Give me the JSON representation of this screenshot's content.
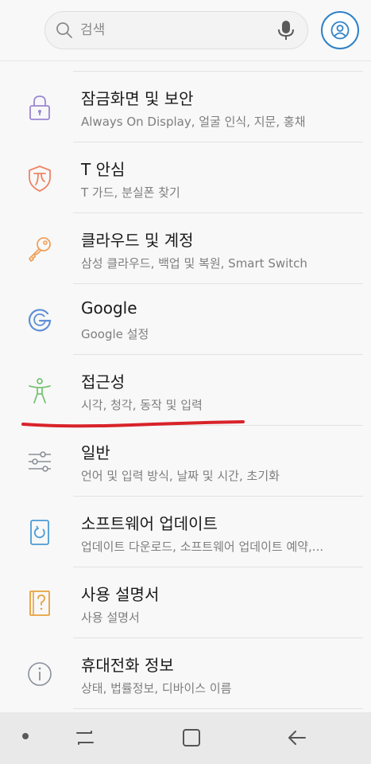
{
  "search": {
    "placeholder": "검색"
  },
  "settings": [
    {
      "title": "잠금화면 및 보안",
      "subtitle": "Always On Display, 얼굴 인식, 지문, 홍채",
      "icon": "lock-icon",
      "color": "#9b87d1"
    },
    {
      "title": "T 안심",
      "subtitle": "T 가드, 분실폰 찾기",
      "icon": "t-shield-icon",
      "color": "#ef8365"
    },
    {
      "title": "클라우드 및 계정",
      "subtitle": "삼성 클라우드, 백업 및 복원, Smart Switch",
      "icon": "key-icon",
      "color": "#efa15b"
    },
    {
      "title": "Google",
      "subtitle": "Google 설정",
      "icon": "google-icon",
      "color": "#5e8fd6"
    },
    {
      "title": "접근성",
      "subtitle": "시각, 청각, 동작 및 입력",
      "icon": "accessibility-icon",
      "color": "#79c276"
    },
    {
      "title": "일반",
      "subtitle": "언어 및 입력 방식, 날짜 및 시간, 초기화",
      "icon": "sliders-icon",
      "color": "#8a8f98"
    },
    {
      "title": "소프트웨어 업데이트",
      "subtitle": "업데이트 다운로드, 소프트웨어 업데이트 예약,...",
      "icon": "software-update-icon",
      "color": "#4a9bd6"
    },
    {
      "title": "사용 설명서",
      "subtitle": "사용 설명서",
      "icon": "manual-icon",
      "color": "#e8a13c"
    },
    {
      "title": "휴대전화 정보",
      "subtitle": "상태, 법률정보, 디바이스 이름",
      "icon": "info-icon",
      "color": "#8a8f98"
    }
  ],
  "colors": {
    "accent": "#2f82c8",
    "annotation": "#d8232a"
  }
}
